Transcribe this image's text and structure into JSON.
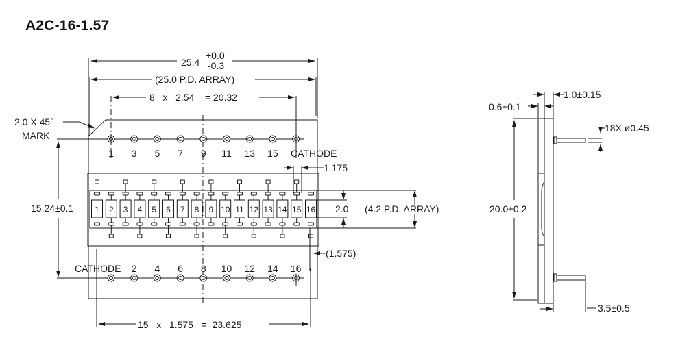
{
  "title": "A2C-16-1.57",
  "front_view": {
    "overall_width": {
      "value": "25.4",
      "tol_plus": "+0.0",
      "tol_minus": "-0.3"
    },
    "array_width": "(25.0 P.D. ARRAY)",
    "pin_pitch_top": "8   x   2.54    = 20.32",
    "chamfer_label": "2.0 X 45°",
    "mark_label": "MARK",
    "height_label": "15.24±0.1",
    "top_pins": [
      "1",
      "3",
      "5",
      "7",
      "9",
      "11",
      "13",
      "15"
    ],
    "top_cathode": "CATHODE",
    "bottom_cathode": "CATHODE",
    "bottom_pins": [
      "2",
      "4",
      "6",
      "8",
      "10",
      "12",
      "14",
      "16"
    ],
    "element_gap": "1.175",
    "element_height": "2.0",
    "array_height": "(4.2 P.D. ARRAY)",
    "element_pitch_ref": "(1.575)",
    "elements": [
      "1",
      "2",
      "3",
      "4",
      "5",
      "6",
      "7",
      "8",
      "9",
      "10",
      "11",
      "12",
      "13",
      "14",
      "15",
      "16"
    ],
    "element_pitch_total": "15   x   1.575   =  23.625"
  },
  "side_view": {
    "thickness_1": "0.6±0.1",
    "thickness_2": "1.0±0.15",
    "pin_diameter": "18X ø0.45",
    "height": "20.0±0.2",
    "pin_length": "3.5±0.5"
  }
}
